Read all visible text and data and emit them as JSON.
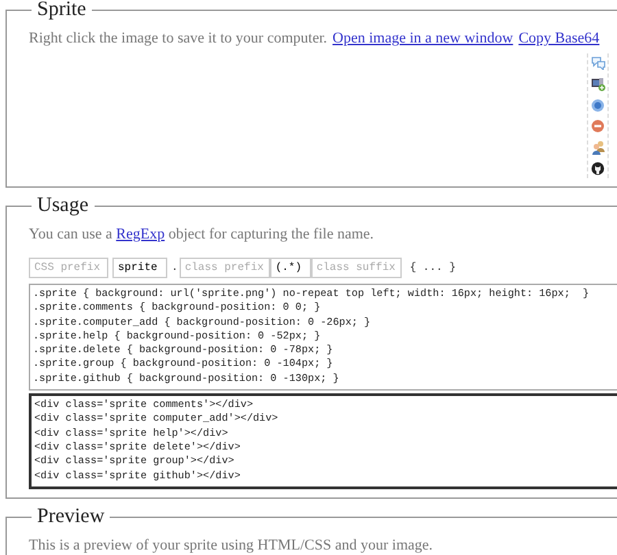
{
  "sprite": {
    "legend": "Sprite",
    "instructions": "Right click the image to save it to your computer.",
    "links": [
      "Open image in a new window",
      "Copy Base64"
    ]
  },
  "usage": {
    "legend": "Usage",
    "intro": {
      "before": "You can use a",
      "link": "RegExp",
      "after": "object for capturing the file name."
    },
    "fields": [
      {
        "kind": "input",
        "placeholder": "CSS prefix"
      },
      {
        "kind": "input",
        "value": "sprite"
      },
      {
        "kind": "separator",
        "text": "."
      },
      {
        "kind": "input",
        "placeholder": "class prefix"
      },
      {
        "kind": "input",
        "value": "(.*)"
      },
      {
        "kind": "input",
        "placeholder": "class suffix"
      },
      {
        "kind": "separator",
        "text": "{ ... }"
      }
    ],
    "css_lines": [
      ".sprite { background: url('sprite.png') no-repeat top left; width: 16px; height: 16px;  }",
      ".sprite.comments { background-position: 0 0; }",
      ".sprite.computer_add { background-position: 0 -26px; }",
      ".sprite.help { background-position: 0 -52px; }",
      ".sprite.delete { background-position: 0 -78px; }",
      ".sprite.group { background-position: 0 -104px; }",
      ".sprite.github { background-position: 0 -130px; }"
    ],
    "html_lines": [
      "<div class='sprite comments'></div>",
      "<div class='sprite computer_add'></div>",
      "<div class='sprite help'></div>",
      "<div class='sprite delete'></div>",
      "<div class='sprite group'></div>",
      "<div class='sprite github'></div>"
    ]
  },
  "preview": {
    "legend": "Preview",
    "description": "This is a preview of your sprite using HTML/CSS and your image."
  }
}
